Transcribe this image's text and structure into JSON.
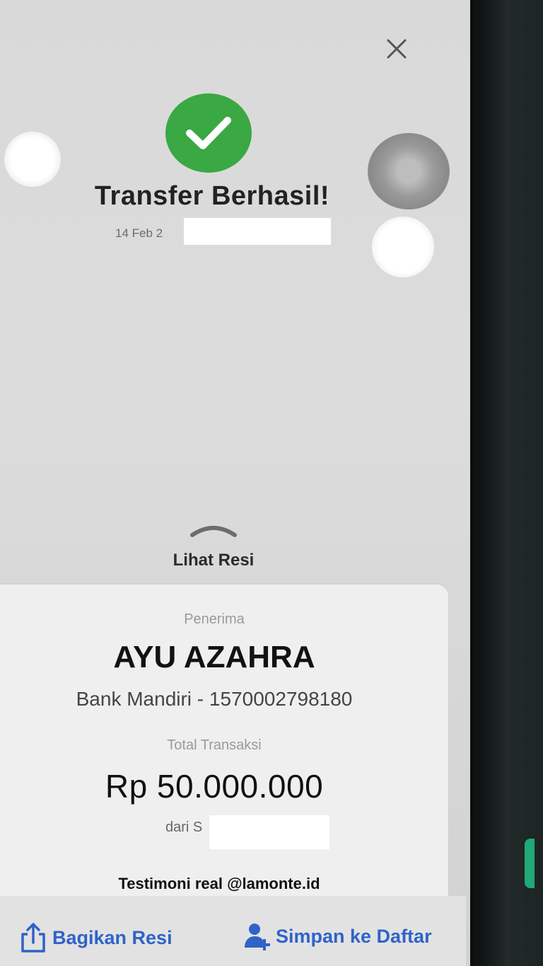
{
  "header": {
    "close_icon": "close-icon",
    "status_icon": "check-circle-icon",
    "status_color": "#3aa843",
    "title": "Transfer Berhasil!",
    "date": "14 Feb 2"
  },
  "receipt_toggle": {
    "icon": "chevron-up-icon",
    "label": "Lihat Resi"
  },
  "receipt": {
    "recipient_label": "Penerima",
    "recipient_name": "AYU AZAHRA",
    "bank_account": "Bank Mandiri - 1570002798180",
    "total_label": "Total Transaksi",
    "amount": "Rp 50.000.000",
    "from_text": "dari S"
  },
  "watermark": "Testimoni real @lamonte.id",
  "actions": {
    "share_label": "Bagikan Resi",
    "share_icon": "share-icon",
    "save_label": "Simpan ke Daftar",
    "save_icon": "add-user-icon",
    "accent": "#2f63c8"
  }
}
